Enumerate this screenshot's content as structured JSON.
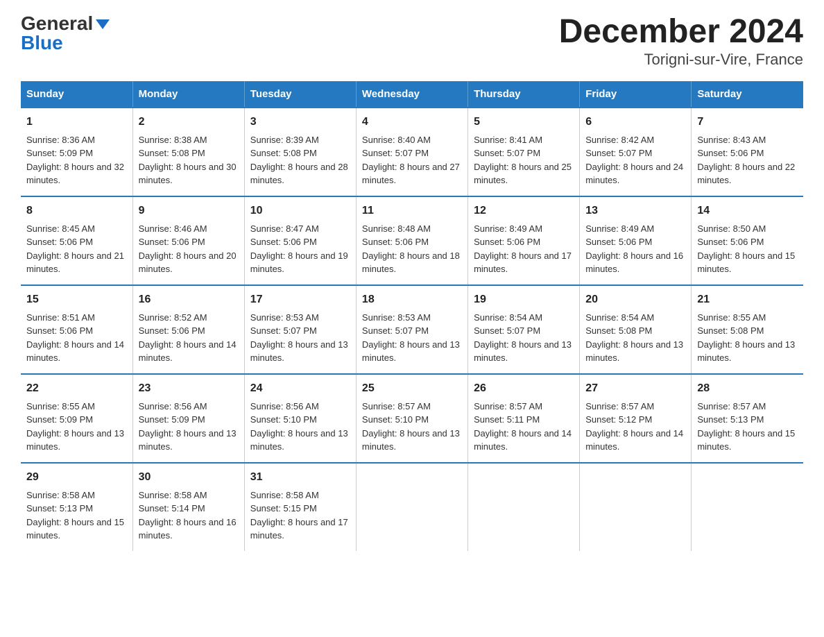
{
  "logo": {
    "general": "General",
    "blue": "Blue"
  },
  "title": "December 2024",
  "subtitle": "Torigni-sur-Vire, France",
  "days_of_week": [
    "Sunday",
    "Monday",
    "Tuesday",
    "Wednesday",
    "Thursday",
    "Friday",
    "Saturday"
  ],
  "weeks": [
    [
      {
        "day": "1",
        "sunrise": "8:36 AM",
        "sunset": "5:09 PM",
        "daylight": "8 hours and 32 minutes."
      },
      {
        "day": "2",
        "sunrise": "8:38 AM",
        "sunset": "5:08 PM",
        "daylight": "8 hours and 30 minutes."
      },
      {
        "day": "3",
        "sunrise": "8:39 AM",
        "sunset": "5:08 PM",
        "daylight": "8 hours and 28 minutes."
      },
      {
        "day": "4",
        "sunrise": "8:40 AM",
        "sunset": "5:07 PM",
        "daylight": "8 hours and 27 minutes."
      },
      {
        "day": "5",
        "sunrise": "8:41 AM",
        "sunset": "5:07 PM",
        "daylight": "8 hours and 25 minutes."
      },
      {
        "day": "6",
        "sunrise": "8:42 AM",
        "sunset": "5:07 PM",
        "daylight": "8 hours and 24 minutes."
      },
      {
        "day": "7",
        "sunrise": "8:43 AM",
        "sunset": "5:06 PM",
        "daylight": "8 hours and 22 minutes."
      }
    ],
    [
      {
        "day": "8",
        "sunrise": "8:45 AM",
        "sunset": "5:06 PM",
        "daylight": "8 hours and 21 minutes."
      },
      {
        "day": "9",
        "sunrise": "8:46 AM",
        "sunset": "5:06 PM",
        "daylight": "8 hours and 20 minutes."
      },
      {
        "day": "10",
        "sunrise": "8:47 AM",
        "sunset": "5:06 PM",
        "daylight": "8 hours and 19 minutes."
      },
      {
        "day": "11",
        "sunrise": "8:48 AM",
        "sunset": "5:06 PM",
        "daylight": "8 hours and 18 minutes."
      },
      {
        "day": "12",
        "sunrise": "8:49 AM",
        "sunset": "5:06 PM",
        "daylight": "8 hours and 17 minutes."
      },
      {
        "day": "13",
        "sunrise": "8:49 AM",
        "sunset": "5:06 PM",
        "daylight": "8 hours and 16 minutes."
      },
      {
        "day": "14",
        "sunrise": "8:50 AM",
        "sunset": "5:06 PM",
        "daylight": "8 hours and 15 minutes."
      }
    ],
    [
      {
        "day": "15",
        "sunrise": "8:51 AM",
        "sunset": "5:06 PM",
        "daylight": "8 hours and 14 minutes."
      },
      {
        "day": "16",
        "sunrise": "8:52 AM",
        "sunset": "5:06 PM",
        "daylight": "8 hours and 14 minutes."
      },
      {
        "day": "17",
        "sunrise": "8:53 AM",
        "sunset": "5:07 PM",
        "daylight": "8 hours and 13 minutes."
      },
      {
        "day": "18",
        "sunrise": "8:53 AM",
        "sunset": "5:07 PM",
        "daylight": "8 hours and 13 minutes."
      },
      {
        "day": "19",
        "sunrise": "8:54 AM",
        "sunset": "5:07 PM",
        "daylight": "8 hours and 13 minutes."
      },
      {
        "day": "20",
        "sunrise": "8:54 AM",
        "sunset": "5:08 PM",
        "daylight": "8 hours and 13 minutes."
      },
      {
        "day": "21",
        "sunrise": "8:55 AM",
        "sunset": "5:08 PM",
        "daylight": "8 hours and 13 minutes."
      }
    ],
    [
      {
        "day": "22",
        "sunrise": "8:55 AM",
        "sunset": "5:09 PM",
        "daylight": "8 hours and 13 minutes."
      },
      {
        "day": "23",
        "sunrise": "8:56 AM",
        "sunset": "5:09 PM",
        "daylight": "8 hours and 13 minutes."
      },
      {
        "day": "24",
        "sunrise": "8:56 AM",
        "sunset": "5:10 PM",
        "daylight": "8 hours and 13 minutes."
      },
      {
        "day": "25",
        "sunrise": "8:57 AM",
        "sunset": "5:10 PM",
        "daylight": "8 hours and 13 minutes."
      },
      {
        "day": "26",
        "sunrise": "8:57 AM",
        "sunset": "5:11 PM",
        "daylight": "8 hours and 14 minutes."
      },
      {
        "day": "27",
        "sunrise": "8:57 AM",
        "sunset": "5:12 PM",
        "daylight": "8 hours and 14 minutes."
      },
      {
        "day": "28",
        "sunrise": "8:57 AM",
        "sunset": "5:13 PM",
        "daylight": "8 hours and 15 minutes."
      }
    ],
    [
      {
        "day": "29",
        "sunrise": "8:58 AM",
        "sunset": "5:13 PM",
        "daylight": "8 hours and 15 minutes."
      },
      {
        "day": "30",
        "sunrise": "8:58 AM",
        "sunset": "5:14 PM",
        "daylight": "8 hours and 16 minutes."
      },
      {
        "day": "31",
        "sunrise": "8:58 AM",
        "sunset": "5:15 PM",
        "daylight": "8 hours and 17 minutes."
      },
      null,
      null,
      null,
      null
    ]
  ]
}
